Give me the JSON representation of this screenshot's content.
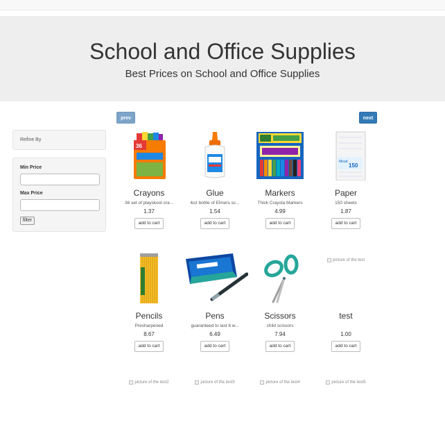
{
  "header": {
    "title": "School and Office Supplies",
    "subtitle": "Best Prices on School and Office Supplies"
  },
  "pager": {
    "prev_label": "prev",
    "next_label": "next"
  },
  "sidebar": {
    "refine_label": "Refine By",
    "min_price_label": "Min Price",
    "min_price_value": "",
    "max_price_label": "Max Price",
    "max_price_value": "",
    "filter_label": "filter"
  },
  "products": [
    {
      "name": "Crayons",
      "description": "36 set of playskool cra...",
      "price": "1.37",
      "cart_label": "add to cart",
      "icon": "crayon-box-icon"
    },
    {
      "name": "Glue",
      "description": "4oz bottle of Elmers sc...",
      "price": "1.54",
      "cart_label": "add to cart",
      "icon": "glue-bottle-icon"
    },
    {
      "name": "Markers",
      "description": "Thick Crayola Markers",
      "price": "4.99",
      "cart_label": "add to cart",
      "icon": "marker-pack-icon"
    },
    {
      "name": "Paper",
      "description": "150 sheets",
      "price": "1.87",
      "cart_label": "add to cart",
      "icon": "paper-pack-icon"
    },
    {
      "name": "Pencils",
      "description": "Presharpened",
      "price": "8.67",
      "cart_label": "add to cart",
      "icon": "pencils-icon"
    },
    {
      "name": "Pens",
      "description": "guaranteed to last 6 w...",
      "price": "6.49",
      "cart_label": "add to cart",
      "icon": "pens-icon"
    },
    {
      "name": "Scissors",
      "description": "child scissors",
      "price": "7.94",
      "cart_label": "add to cart",
      "icon": "scissors-icon"
    },
    {
      "name": "test",
      "description": "",
      "price": "1.00",
      "cart_label": "add to cart",
      "image_alt": "picture of the test"
    }
  ],
  "more_products": [
    {
      "image_alt": "picture of the test2"
    },
    {
      "image_alt": "picture of the test3"
    },
    {
      "image_alt": "picture of the test4"
    },
    {
      "image_alt": "picture of the test5"
    }
  ],
  "colors": {
    "next": "#337ab7",
    "prev": "#7da4c9",
    "jumbotron": "#eeeeee"
  }
}
